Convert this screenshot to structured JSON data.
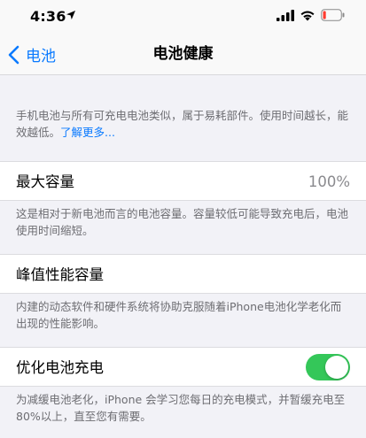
{
  "status_bar": {
    "time": "4:36",
    "icons": [
      "location-arrow-icon",
      "cellular-signal-icon",
      "wifi-icon",
      "battery-low-icon"
    ],
    "battery_color": "#ff3b30"
  },
  "nav": {
    "back_label": "电池",
    "title": "电池健康",
    "accent": "#0a7aff"
  },
  "intro": {
    "text": "手机电池与所有可充电电池类似，属于易耗部件。使用时间越长，能效越低。",
    "link": "了解更多..."
  },
  "max_capacity": {
    "label": "最大容量",
    "value": "100%",
    "description": "这是相对于新电池而言的电池容量。容量较低可能导致充电后，电池使用时间缩短。"
  },
  "peak_performance": {
    "label": "峰值性能容量",
    "description": "内建的动态软件和硬件系统将协助克服随着iPhone电池化学老化而出现的性能影响。"
  },
  "optimized_charging": {
    "label": "优化电池充电",
    "enabled": true,
    "toggle_color": "#34c759",
    "description": "为减缓电池老化，iPhone 会学习您每日的充电模式，并暂缓充电至80%以上，直至您有需要。"
  }
}
